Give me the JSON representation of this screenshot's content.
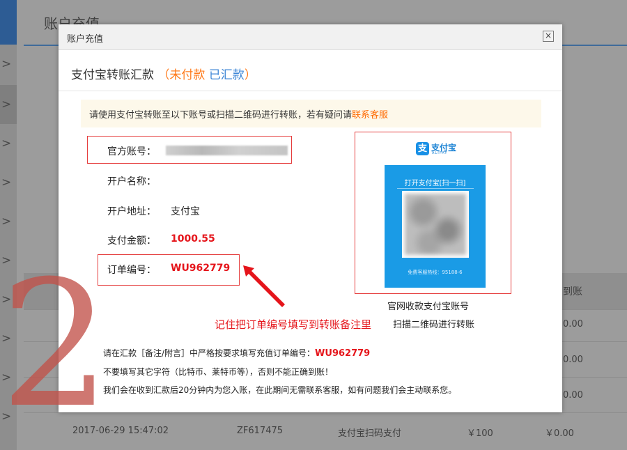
{
  "background": {
    "page_title": "账户充值",
    "column_header_partial": "到账",
    "rows": [
      {
        "time": "",
        "order_no": "",
        "method": "",
        "amount": "",
        "credited": "0.00"
      },
      {
        "time": "",
        "order_no": "",
        "method": "",
        "amount": "",
        "credited": "0.00"
      },
      {
        "time": "",
        "order_no": "",
        "method": "",
        "amount": "",
        "credited": "0.00"
      },
      {
        "time": "2017-06-29 15:47:02",
        "order_no": "ZF617475",
        "method": "支付宝扫码支付",
        "amount": "￥100",
        "credited": "￥0.00"
      }
    ],
    "overlay_digit": "2",
    "chevron": ">"
  },
  "dialog": {
    "title": "账户充值",
    "close_glyph": "×",
    "heading": {
      "main": "支付宝转账汇款",
      "paren_open": "（",
      "unpaid": "未付款",
      "paid": "已汇款",
      "paren_close": "）"
    },
    "notice": {
      "text": "请使用支付宝转账至以下账号或扫描二维码进行转账，若有疑问请",
      "link": "联系客服"
    },
    "fields": {
      "account_label": "官方账号：",
      "name_label": "开户名称：",
      "address_label": "开户地址：",
      "address_value": "支付宝",
      "amount_label": "支付金额：",
      "amount_value": "1000.55",
      "order_label": "订单编号：",
      "order_value": "WU962779"
    },
    "qr": {
      "brand": "支付宝",
      "brand_sub": "ALIPAY",
      "card_title": "打开支付宝[扫一扫]",
      "card_footer": "免费客服热线：95188-6",
      "caption1": "官网收款支付宝账号",
      "caption2": "扫描二维码进行转账"
    },
    "annotation": "记住把订单编号填写到转账备注里",
    "instructions": {
      "line1_prefix": "请在汇款［备注/附言］中严格按要求填写充值订单编号：",
      "line1_order": "WU962779",
      "line2": "不要填写其它字符（比特币、莱特币等），否则不能正确到账！",
      "line3": "我们会在收到汇款后20分钟内为您入账，在此期间无需联系客服，如有问题我们会主动联系您。"
    }
  },
  "colors": {
    "accent_orange": "#ff7a1a",
    "accent_blue": "#3d86d6",
    "alert_red": "#e5151b",
    "alipay_blue": "#1a9be6"
  }
}
